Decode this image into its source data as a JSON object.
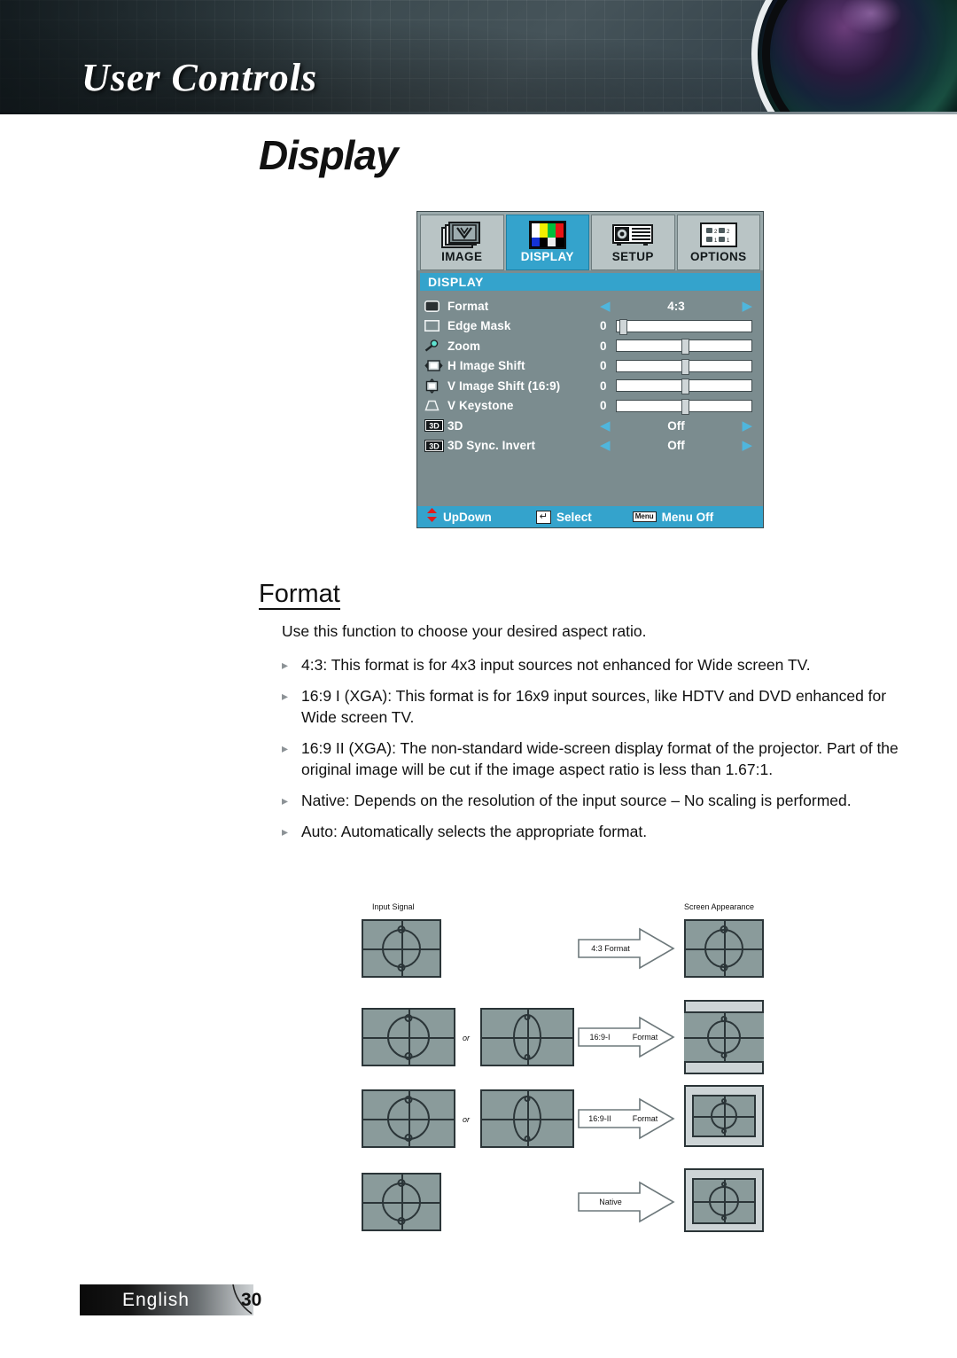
{
  "banner": {
    "title": "User Controls",
    "lens_icon": "camera-lens-icon"
  },
  "page": {
    "title": "Display"
  },
  "osd": {
    "tabs": [
      {
        "label": "IMAGE",
        "icon": "image-stack-icon",
        "active": false
      },
      {
        "label": "DISPLAY",
        "icon": "color-bars-icon",
        "active": true
      },
      {
        "label": "SETUP",
        "icon": "projector-icon",
        "active": false
      },
      {
        "label": "OPTIONS",
        "icon": "options-grid-icon",
        "active": false
      }
    ],
    "section_title": "DISPLAY",
    "rows": [
      {
        "icon": "format-screen-icon",
        "label": "Format",
        "type": "select",
        "value": "4:3"
      },
      {
        "icon": "edge-mask-icon",
        "label": "Edge Mask",
        "type": "slider",
        "value": "0",
        "knob_pct": 2
      },
      {
        "icon": "zoom-magnifier-icon",
        "label": "Zoom",
        "type": "slider",
        "value": "0",
        "knob_pct": 48
      },
      {
        "icon": "h-image-shift-icon",
        "label": "H Image Shift",
        "type": "slider",
        "value": "0",
        "knob_pct": 48
      },
      {
        "icon": "v-image-shift-icon",
        "label": "V Image Shift (16:9)",
        "type": "slider",
        "value": "0",
        "knob_pct": 48
      },
      {
        "icon": "v-keystone-icon",
        "label": "V Keystone",
        "type": "slider",
        "value": "0",
        "knob_pct": 48
      },
      {
        "icon": "3d-icon",
        "label": "3D",
        "type": "select",
        "value": "Off"
      },
      {
        "icon": "3d-icon",
        "label": "3D Sync. Invert",
        "type": "select",
        "value": "Off"
      }
    ],
    "footer": [
      {
        "icon": "updown-arrows-icon",
        "label": "UpDown"
      },
      {
        "icon": "enter-key-icon",
        "label": "Select",
        "key": "↵"
      },
      {
        "icon": "menu-key-icon",
        "label": "Menu Off",
        "key": "Menu"
      }
    ]
  },
  "format": {
    "heading": "Format",
    "intro": "Use this function to choose your desired aspect ratio.",
    "bullets": [
      "4:3: This format is for 4x3 input sources not enhanced for Wide screen TV.",
      "16:9 I (XGA): This format is for 16x9 input sources, like HDTV and DVD enhanced for Wide screen TV.",
      "16:9 II (XGA): The non-standard wide-screen display format of the projector. Part of the original image will be cut if the image aspect ratio is less than 1.67:1.",
      "Native: Depends on the resolution of the input source – No scaling is performed.",
      "Auto: Automatically selects the appropriate format."
    ]
  },
  "diagram": {
    "input_label": "Input Signal",
    "screen_label": "Screen Appearance",
    "or_label": "or",
    "rows": [
      {
        "arrow_left": "4:3 Format",
        "arrow_right": ""
      },
      {
        "arrow_left": "16:9-I",
        "arrow_right": "Format"
      },
      {
        "arrow_left": "16:9-II",
        "arrow_right": "Format"
      },
      {
        "arrow_left": "Native",
        "arrow_right": ""
      }
    ]
  },
  "footer": {
    "language": "English",
    "page_number": "30"
  },
  "colors": {
    "osd_accent": "#34a3cc",
    "osd_body": "#7b8c8f",
    "osd_tabbar": "#9aa9ab",
    "diagram_fill": "#8a9b9b",
    "diagram_stroke": "#2b3538",
    "banner_dark": "#2f3d42"
  }
}
